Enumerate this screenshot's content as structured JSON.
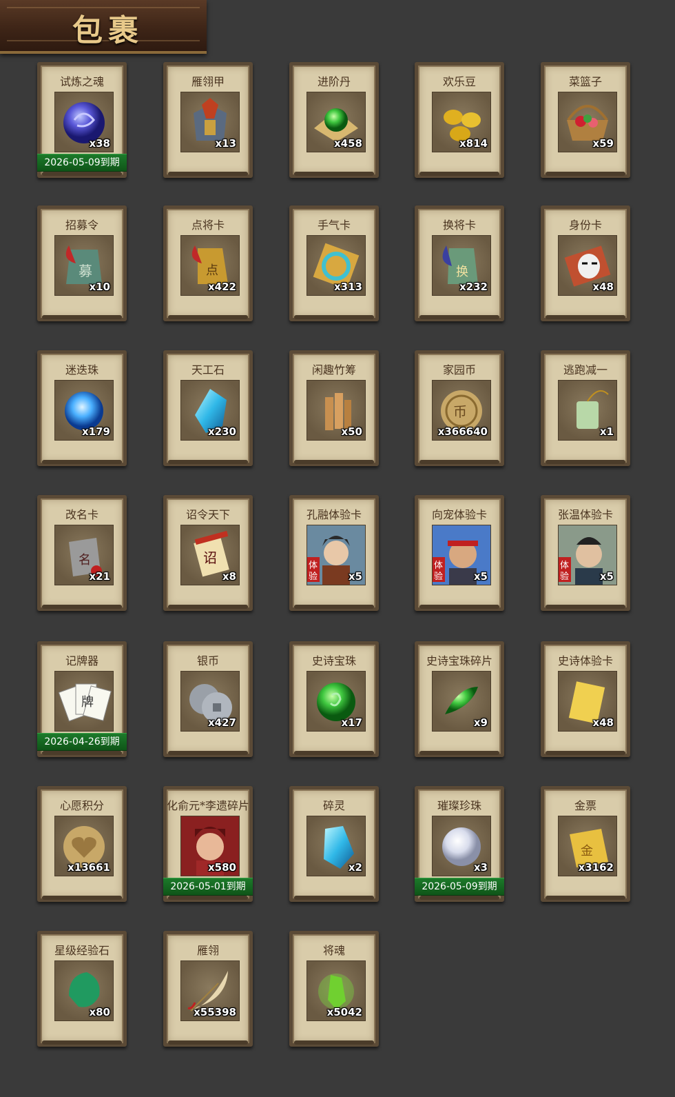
{
  "header": {
    "title": "包裹"
  },
  "items": [
    {
      "name": "试炼之魂",
      "qty": "x38",
      "expiry": "2026-05-09到期",
      "icon": "dragon-orb-icon"
    },
    {
      "name": "雁翎甲",
      "qty": "x13",
      "expiry": "",
      "icon": "armor-icon"
    },
    {
      "name": "进阶丹",
      "qty": "x458",
      "expiry": "",
      "icon": "green-pill-icon"
    },
    {
      "name": "欢乐豆",
      "qty": "x814",
      "expiry": "",
      "icon": "gold-beans-icon"
    },
    {
      "name": "菜篮子",
      "qty": "x59",
      "expiry": "",
      "icon": "basket-icon"
    },
    {
      "name": "招募令",
      "qty": "x10",
      "expiry": "",
      "icon": "recruit-token-icon"
    },
    {
      "name": "点将卡",
      "qty": "x422",
      "expiry": "",
      "icon": "general-card-icon"
    },
    {
      "name": "手气卡",
      "qty": "x313",
      "expiry": "",
      "icon": "luck-card-icon"
    },
    {
      "name": "换将卡",
      "qty": "x232",
      "expiry": "",
      "icon": "swap-card-icon"
    },
    {
      "name": "身份卡",
      "qty": "x48",
      "expiry": "",
      "icon": "mask-card-icon"
    },
    {
      "name": "迷迭珠",
      "qty": "x179",
      "expiry": "",
      "icon": "blue-orb-icon"
    },
    {
      "name": "天工石",
      "qty": "x230",
      "expiry": "",
      "icon": "crystal-icon"
    },
    {
      "name": "闲趣竹筹",
      "qty": "x50",
      "expiry": "",
      "icon": "bamboo-tally-icon"
    },
    {
      "name": "家园币",
      "qty": "x366640",
      "expiry": "",
      "icon": "home-coin-icon"
    },
    {
      "name": "逃跑减一",
      "qty": "x1",
      "expiry": "",
      "icon": "jade-tag-icon"
    },
    {
      "name": "改名卡",
      "qty": "x21",
      "expiry": "",
      "icon": "rename-card-icon"
    },
    {
      "name": "诏令天下",
      "qty": "x8",
      "expiry": "",
      "icon": "scroll-icon"
    },
    {
      "name": "孔融体验卡",
      "qty": "x5",
      "expiry": "",
      "icon": "portrait-kongrong-icon"
    },
    {
      "name": "向宠体验卡",
      "qty": "x5",
      "expiry": "",
      "icon": "portrait-xiangchong-icon"
    },
    {
      "name": "张温体验卡",
      "qty": "x5",
      "expiry": "",
      "icon": "portrait-zhangwen-icon"
    },
    {
      "name": "记牌器",
      "qty": "",
      "expiry": "2026-04-26到期",
      "icon": "playing-cards-icon"
    },
    {
      "name": "银币",
      "qty": "x427",
      "expiry": "",
      "icon": "silver-coins-icon"
    },
    {
      "name": "史诗宝珠",
      "qty": "x17",
      "expiry": "",
      "icon": "green-orb-icon"
    },
    {
      "name": "史诗宝珠碎片",
      "qty": "x9",
      "expiry": "",
      "icon": "green-shard-icon"
    },
    {
      "name": "史诗体验卡",
      "qty": "x48",
      "expiry": "",
      "icon": "gold-card-icon"
    },
    {
      "name": "心愿积分",
      "qty": "x13661",
      "expiry": "",
      "icon": "heart-coin-icon"
    },
    {
      "name": "化俞元*李遗碎片",
      "qty": "x580",
      "expiry": "2026-05-01到期",
      "icon": "portrait-fragment-icon"
    },
    {
      "name": "碎灵",
      "qty": "x2",
      "expiry": "",
      "icon": "ice-crystal-icon"
    },
    {
      "name": "璀璨珍珠",
      "qty": "x3",
      "expiry": "2026-05-09到期",
      "icon": "pearl-icon"
    },
    {
      "name": "金票",
      "qty": "x3162",
      "expiry": "",
      "icon": "gold-ticket-icon"
    },
    {
      "name": "星级经验石",
      "qty": "x80",
      "expiry": "",
      "icon": "green-stone-icon"
    },
    {
      "name": "雁翎",
      "qty": "x55398",
      "expiry": "",
      "icon": "feather-icon"
    },
    {
      "name": "将魂",
      "qty": "x5042",
      "expiry": "",
      "icon": "soul-crystal-icon"
    }
  ]
}
